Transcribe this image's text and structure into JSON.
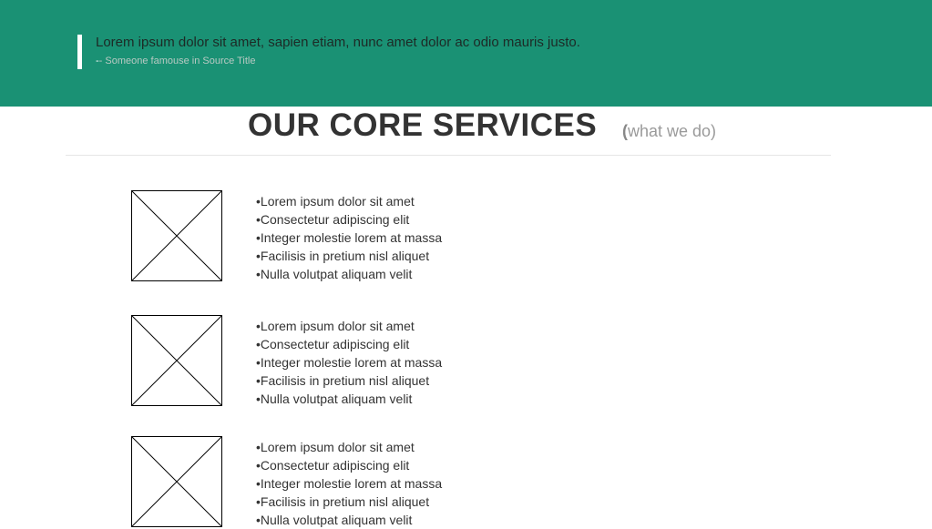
{
  "quote": {
    "text": "Lorem ipsum dolor sit amet, sapien etiam, nunc amet dolor ac odio mauris justo.",
    "dash": "-",
    "source": "- Someone famouse in Source Title"
  },
  "section": {
    "title": "OUR CORE SERVICES",
    "subtitle_open": "(",
    "subtitle": "what we do)"
  },
  "services": [
    {
      "image_icon": "placeholder-image-icon",
      "items": [
        "Lorem ipsum dolor sit amet",
        "Consectetur adipiscing elit",
        "Integer molestie lorem at massa",
        "Facilisis in pretium nisl aliquet",
        "Nulla volutpat aliquam velit"
      ]
    },
    {
      "image_icon": "placeholder-image-icon",
      "items": [
        "Lorem ipsum dolor sit amet",
        "Consectetur adipiscing elit",
        "Integer molestie lorem at massa",
        "Facilisis in pretium nisl aliquet",
        "Nulla volutpat aliquam velit"
      ]
    },
    {
      "image_icon": "placeholder-image-icon",
      "items": [
        "Lorem ipsum dolor sit amet",
        "Consectetur adipiscing elit",
        "Integer molestie lorem at massa",
        "Facilisis in pretium nisl aliquet",
        "Nulla volutpat aliquam velit"
      ]
    }
  ],
  "colors": {
    "hero_background": "#1a9174",
    "heading": "#333333",
    "muted": "#9a9a9a"
  }
}
